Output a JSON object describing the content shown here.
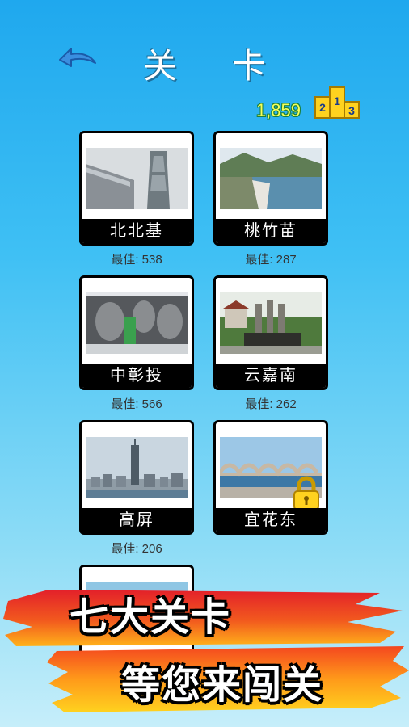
{
  "header": {
    "title": "关 卡",
    "score": "1,859",
    "back_icon": "back-arrow-icon",
    "leaderboard_icon": "podium-icon",
    "podium_digits": [
      "2",
      "1",
      "3"
    ]
  },
  "levels": [
    {
      "name": "北北基",
      "best": "最佳: 538",
      "image": "taipei-101-photo",
      "locked": false
    },
    {
      "name": "桃竹苗",
      "best": "最佳: 287",
      "image": "dam-lake-photo",
      "locked": false
    },
    {
      "name": "中彰投",
      "best": "最佳: 566",
      "image": "opera-house-photo",
      "locked": false
    },
    {
      "name": "云嘉南",
      "best": "最佳: 262",
      "image": "monument-photo",
      "locked": false
    },
    {
      "name": "高屏",
      "best": "最佳: 206",
      "image": "kaohsiung-skyline-photo",
      "locked": false
    },
    {
      "name": "宜花东",
      "best": "",
      "image": "arch-bridge-photo",
      "locked": true
    }
  ],
  "banner": {
    "line1": "七大关卡",
    "line2": "等您来闯关"
  },
  "colors": {
    "sky_top": "#1fa8ee",
    "sky_bottom": "#c6eefa",
    "score": "#f5ff5a",
    "podium": "#ffd21f",
    "banner_red": "#e3202a",
    "banner_orange": "#ff9a1a"
  }
}
